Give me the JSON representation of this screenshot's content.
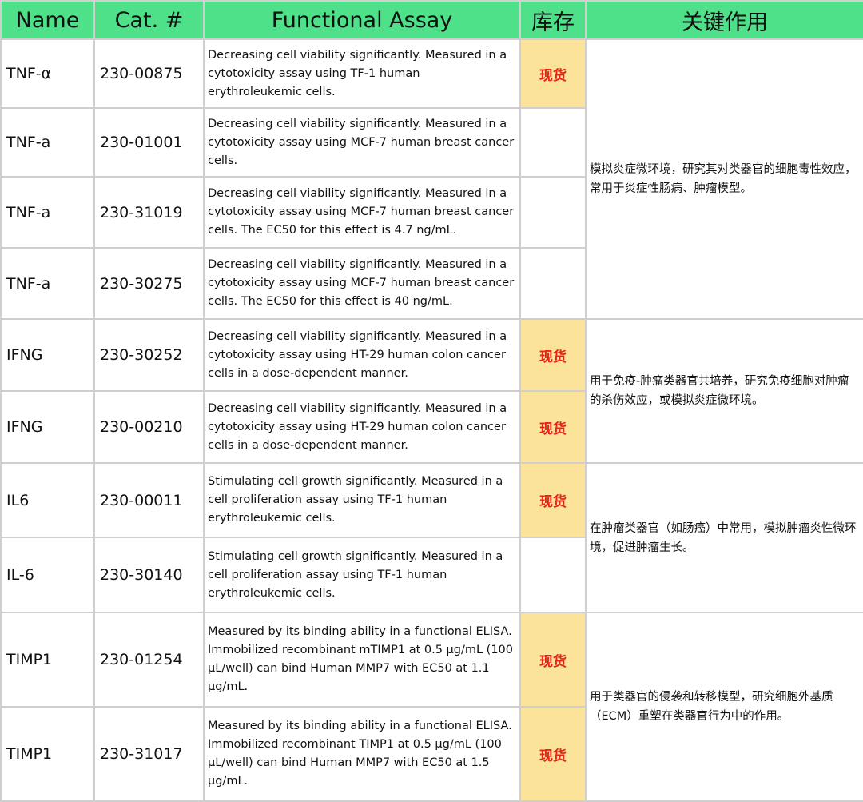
{
  "headers": {
    "name": "Name",
    "cat": "Cat. #",
    "assay": "Functional Assay",
    "stock": "库存",
    "role": "关键作用"
  },
  "colors": {
    "header_bg": "#4fe08a",
    "stock_bg": "#fbe39a",
    "stock_text": "#e8231a"
  },
  "rows": [
    {
      "name": "TNF-α",
      "cat": "230-00875",
      "assay": "Decreasing cell viability significantly. Measured in a cytotoxicity assay using TF-1 human erythroleukemic cells.",
      "stock": "现货"
    },
    {
      "name": "TNF-a",
      "cat": "230-01001",
      "assay": "Decreasing cell viability significantly. Measured in a cytotoxicity assay using MCF-7 human breast cancer cells.",
      "stock": ""
    },
    {
      "name": "TNF-a",
      "cat": "230-31019",
      "assay": "Decreasing cell viability significantly. Measured in a cytotoxicity assay using MCF-7 human breast cancer cells. The EC50 for this effect is 4.7 ng/mL.",
      "stock": ""
    },
    {
      "name": "TNF-a",
      "cat": "230-30275",
      "assay": "Decreasing cell viability significantly. Measured in a cytotoxicity assay using MCF-7 human breast cancer cells. The EC50 for this effect is 40 ng/mL.",
      "stock": ""
    },
    {
      "name": "IFNG",
      "cat": "230-30252",
      "assay": "Decreasing cell viability significantly. Measured in a cytotoxicity assay using HT-29 human colon cancer cells in a dose-dependent manner.",
      "stock": "现货"
    },
    {
      "name": "IFNG",
      "cat": "230-00210",
      "assay": "Decreasing cell viability significantly. Measured in a cytotoxicity assay using HT-29 human colon cancer cells in a dose-dependent manner.",
      "stock": "现货"
    },
    {
      "name": "IL6",
      "cat": "230-00011",
      "assay": "Stimulating cell growth significantly. Measured in a cell proliferation assay using TF-1 human erythroleukemic cells.",
      "stock": "现货"
    },
    {
      "name": "IL-6",
      "cat": "230-30140",
      "assay": "Stimulating cell growth significantly. Measured in a cell proliferation assay using TF-1 human erythroleukemic cells.",
      "stock": ""
    },
    {
      "name": "TIMP1",
      "cat": "230-01254",
      "assay": "Measured by its binding ability in a functional ELISA. Immobilized recombinant mTIMP1 at 0.5 μg/mL (100 μL/well) can bind Human MMP7 with EC50 at 1.1 μg/mL.",
      "stock": "现货"
    },
    {
      "name": "TIMP1",
      "cat": "230-31017",
      "assay": "Measured by its binding ability in a functional ELISA. Immobilized recombinant TIMP1 at 0.5 μg/mL (100 μL/well) can bind Human MMP7 with EC50 at 1.5 μg/mL.",
      "stock": "现货"
    }
  ],
  "roles": [
    "模拟炎症微环境，研究其对类器官的细胞毒性效应，常用于炎症性肠病、肿瘤模型。",
    "用于免疫-肿瘤类器官共培养，研究免疫细胞对肿瘤的杀伤效应，或模拟炎症微环境。",
    "在肿瘤类器官（如肠癌）中常用，模拟肿瘤炎性微环境，促进肿瘤生长。",
    "用于类器官的侵袭和转移模型，研究细胞外基质（ECM）重塑在类器官行为中的作用。"
  ]
}
